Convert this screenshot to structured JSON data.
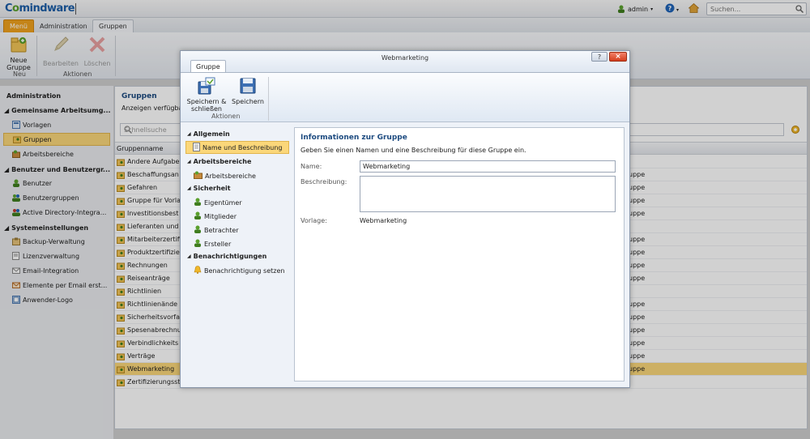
{
  "app": {
    "logo": "Comindware"
  },
  "topbar": {
    "user": "admin",
    "search_placeholder": "Suchen..."
  },
  "tabs": [
    {
      "label": "Menü"
    },
    {
      "label": "Administration"
    },
    {
      "label": "Gruppen"
    }
  ],
  "ribbon": {
    "new_label": "Neue Gruppe",
    "edit_label": "Bearbeiten",
    "delete_label": "Löschen",
    "group_new": "Neu",
    "group_actions": "Aktionen"
  },
  "sidebar": {
    "title": "Administration",
    "items": [
      {
        "label": "Gemeinsame Arbeitsumg...",
        "section": true
      },
      {
        "label": "Vorlagen"
      },
      {
        "label": "Gruppen",
        "active": true
      },
      {
        "label": "Arbeitsbereiche"
      },
      {
        "label": "Benutzer und Benutzergr...",
        "section": true
      },
      {
        "label": "Benutzer"
      },
      {
        "label": "Benutzergruppen"
      },
      {
        "label": "Active Directory-Integra..."
      },
      {
        "label": "Systemeinstellungen",
        "section": true
      },
      {
        "label": "Backup-Verwaltung"
      },
      {
        "label": "Lizenzverwaltung"
      },
      {
        "label": "Email-Integration"
      },
      {
        "label": "Elemente per Email erst..."
      },
      {
        "label": "Anwender-Logo"
      }
    ]
  },
  "main": {
    "title": "Gruppen",
    "subtitle": "Anzeigen verfügba",
    "filter_placeholder": "Schnellsuche",
    "column_header": "Gruppenname",
    "rows": [
      {
        "name": "Andere Aufgabe",
        "right": ""
      },
      {
        "name": "Beschaffungsan",
        "right": "uppe"
      },
      {
        "name": "Gefahren",
        "right": "uppe"
      },
      {
        "name": "Gruppe für Vorla",
        "right": "uppe"
      },
      {
        "name": "Investitionsbest",
        "right": "uppe"
      },
      {
        "name": "Lieferanten und",
        "right": ""
      },
      {
        "name": "Mitarbeiterzertifi",
        "right": "uppe"
      },
      {
        "name": "Produktzertifizie",
        "right": "uppe"
      },
      {
        "name": "Rechnungen",
        "right": "uppe"
      },
      {
        "name": "Reiseanträge",
        "right": "uppe"
      },
      {
        "name": "Richtlinien",
        "right": ""
      },
      {
        "name": "Richtlinienände",
        "right": "uppe"
      },
      {
        "name": "Sicherheitsvorfa",
        "right": "uppe"
      },
      {
        "name": "Spesenabrechnu",
        "right": "uppe"
      },
      {
        "name": "Verbindlichkeits",
        "right": "uppe"
      },
      {
        "name": "Verträge",
        "right": "uppe"
      },
      {
        "name": "Webmarketing",
        "right": "uppe",
        "selected": true
      },
      {
        "name": "Zertifizierungsst",
        "right": ""
      }
    ]
  },
  "dialog": {
    "title": "Webmarketing",
    "tab": "Gruppe",
    "help": "?",
    "close": "×",
    "save_close_label": "Speichern & schließen",
    "save_label": "Speichern",
    "actions_label": "Aktionen",
    "nav": {
      "allgemein": "Allgemein",
      "name_desc": "Name und Beschreibung",
      "arbeitsbereiche_sec": "Arbeitsbereiche",
      "arbeitsbereiche": "Arbeitsbereiche",
      "sicherheit": "Sicherheit",
      "eigentuemer": "Eigentümer",
      "mitglieder": "Mitglieder",
      "betrachter": "Betrachter",
      "ersteller": "Ersteller",
      "benachrichtigungen": "Benachrichtigungen",
      "benachrichtigung_setzen": "Benachrichtigung setzen"
    },
    "content": {
      "title": "Informationen zur Gruppe",
      "description": "Geben Sie einen Namen und eine Beschreibung für diese Gruppe ein.",
      "name_label": "Name:",
      "name_value": "Webmarketing",
      "desc_label": "Beschreibung:",
      "desc_value": "",
      "template_label": "Vorlage:",
      "template_value": "Webmarketing"
    }
  }
}
